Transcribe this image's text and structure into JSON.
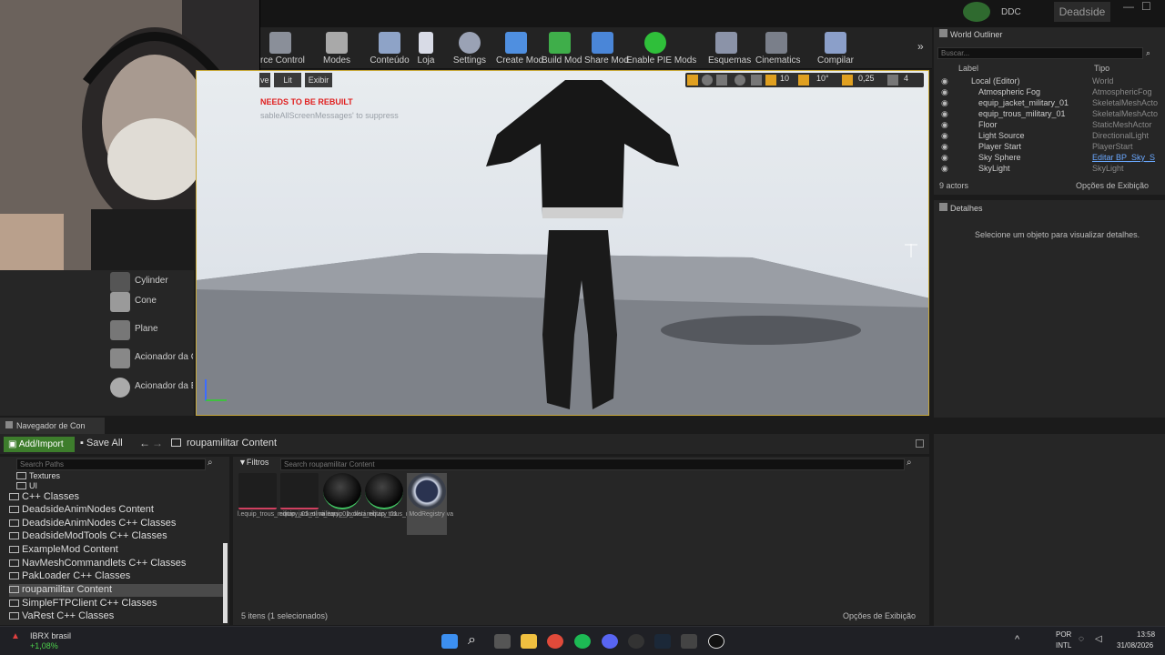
{
  "title_bar": {
    "ddc": "DDC",
    "project": "Deadside"
  },
  "toolbar": {
    "items": [
      {
        "label": "rce Control",
        "icon": "source-control-icon"
      },
      {
        "label": "Modes",
        "icon": "modes-icon"
      },
      {
        "label": "Conteúdo",
        "icon": "content-icon"
      },
      {
        "label": "Loja",
        "icon": "marketplace-icon"
      },
      {
        "label": "Settings",
        "icon": "settings-icon"
      },
      {
        "label": "Create Mod",
        "icon": "create-mod-icon"
      },
      {
        "label": "Build Mod",
        "icon": "build-mod-icon"
      },
      {
        "label": "Share Mod",
        "icon": "share-mod-icon"
      },
      {
        "label": "Enable PIE Mods",
        "icon": "power-icon"
      },
      {
        "label": "Esquemas",
        "icon": "blueprints-icon"
      },
      {
        "label": "Cinematics",
        "icon": "clapper-icon"
      },
      {
        "label": "Compilar",
        "icon": "build-icon"
      }
    ]
  },
  "place_panel": {
    "items": [
      "Cylinder",
      "Cone",
      "Plane",
      "Acionador da C",
      "Acionador da E"
    ]
  },
  "viewport": {
    "buttons": {
      "perspective": "ve",
      "lit": "Lit",
      "show": "Exibir"
    },
    "warning": "NEEDS TO BE REBUILT",
    "suppress": "sableAllScreenMessages' to suppress",
    "snap": {
      "grid": "10",
      "rotation": "10°",
      "scale": "0,25",
      "camera_speed": "4"
    }
  },
  "world_outliner": {
    "tab": "World Outliner",
    "search_placeholder": "Buscar...",
    "col_label": "Label",
    "col_type": "Tipo",
    "rows": [
      {
        "label": "Local (Editor)",
        "type": "World"
      },
      {
        "label": "Atmospheric Fog",
        "type": "AtmosphericFog"
      },
      {
        "label": "equip_jacket_military_01",
        "type": "SkeletalMeshActo"
      },
      {
        "label": "equip_trous_military_01",
        "type": "SkeletalMeshActo"
      },
      {
        "label": "Floor",
        "type": "StaticMeshActor"
      },
      {
        "label": "Light Source",
        "type": "DirectionalLight"
      },
      {
        "label": "Player Start",
        "type": "PlayerStart"
      },
      {
        "label": "Sky Sphere",
        "type": "Editar BP_Sky_S"
      },
      {
        "label": "SkyLight",
        "type": "SkyLight"
      }
    ],
    "count": "9 actors",
    "view_options": "Opções de Exibição"
  },
  "details": {
    "tab": "Detalhes",
    "empty": "Selecione um objeto para visualizar detalhes."
  },
  "content_browser": {
    "tab": "Navegador de Con",
    "add_import": "Add/Import",
    "save_all": "Save All",
    "path": "roupamilitar Content",
    "search_paths_placeholder": "Search Paths",
    "filters": "Filtros",
    "search_placeholder": "Search roupamilitar Content",
    "folders": [
      "Textures",
      "UI",
      "C++ Classes",
      "DeadsideAnimNodes Content",
      "DeadsideAnimNodes C++ Classes",
      "DeadsideModTools C++ Classes",
      "ExampleMod Content",
      "NavMeshCommandlets C++ Classes",
      "PakLoader C++ Classes",
      "roupamilitar Content",
      "SimpleFTPClient C++ Classes",
      "VaRest C++ Classes"
    ],
    "assets": [
      {
        "name": "l.equip_trous_military_01_oliva"
      },
      {
        "name": "equip_jacket_military_01_oliva"
      },
      {
        "name": "i_equip_jacket_military_01"
      },
      {
        "name": "i_equip_trous_military_01_oliva"
      },
      {
        "name": "ModRegistry"
      }
    ],
    "status": "5 itens (1 selecionados)",
    "view_options": "Opções de Exibição"
  },
  "taskbar": {
    "stock_name": "IBRX brasil",
    "stock_change": "+1,08%",
    "lang1": "POR",
    "lang2": "INTL",
    "time": "13:58",
    "date": "31/08/2026"
  }
}
